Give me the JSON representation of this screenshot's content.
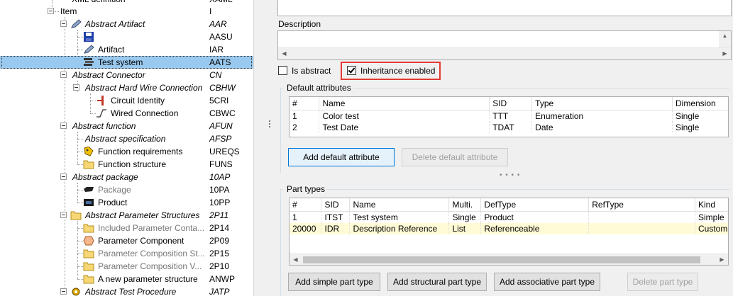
{
  "tree": {
    "top_cut_label": "XML definition",
    "top_cut_sid": "XAML",
    "items": [
      {
        "label": "Item",
        "sid": "I",
        "icon": "none",
        "italic": false,
        "gray": false
      },
      {
        "label": "Abstract Artifact",
        "sid": "AAR",
        "icon": "pen-icon",
        "italic": true,
        "gray": false
      },
      {
        "label": "",
        "sid": "AASU",
        "icon": "floppy-disk-icon",
        "italic": false,
        "gray": false
      },
      {
        "label": "Artifact",
        "sid": "IAR",
        "icon": "pen-icon",
        "italic": false,
        "gray": false
      },
      {
        "label": "Test system",
        "sid": "AATS",
        "icon": "test-system-icon",
        "italic": false,
        "gray": false,
        "selected": true
      },
      {
        "label": "Abstract Connector",
        "sid": "CN",
        "icon": "none",
        "italic": true,
        "gray": false
      },
      {
        "label": "Abstract Hard Wire Connection",
        "sid": "CBHW",
        "icon": "none",
        "italic": true,
        "gray": false
      },
      {
        "label": "Circuit Identity",
        "sid": "5CRI",
        "icon": "connector-pin-icon",
        "italic": false,
        "gray": false
      },
      {
        "label": "Wired Connection",
        "sid": "CBWC",
        "icon": "wire-icon",
        "italic": false,
        "gray": false
      },
      {
        "label": "Abstract function",
        "sid": "AFUN",
        "icon": "none",
        "italic": true,
        "gray": false
      },
      {
        "label": "Abstract specification",
        "sid": "AFSP",
        "icon": "none",
        "italic": true,
        "gray": false
      },
      {
        "label": "Function requirements",
        "sid": "UREQS",
        "icon": "requirements-icon",
        "italic": false,
        "gray": false
      },
      {
        "label": "Function structure",
        "sid": "FUNS",
        "icon": "folder-icon",
        "italic": false,
        "gray": false
      },
      {
        "label": "Abstract package",
        "sid": "10AP",
        "icon": "none",
        "italic": true,
        "gray": false
      },
      {
        "label": "Package",
        "sid": "10PA",
        "icon": "package-icon",
        "italic": false,
        "gray": true
      },
      {
        "label": "Product",
        "sid": "10PP",
        "icon": "product-icon",
        "italic": false,
        "gray": false
      },
      {
        "label": "Abstract Parameter Structures",
        "sid": "2P11",
        "icon": "folder-icon",
        "italic": true,
        "gray": false
      },
      {
        "label": "Included Parameter Conta...",
        "sid": "2P14",
        "icon": "folder-icon",
        "italic": false,
        "gray": true
      },
      {
        "label": "Parameter Component",
        "sid": "2P09",
        "icon": "hexagon-icon",
        "italic": false,
        "gray": false
      },
      {
        "label": "Parameter Composition St...",
        "sid": "2P15",
        "icon": "folder-icon",
        "italic": false,
        "gray": true
      },
      {
        "label": "Parameter Composition V...",
        "sid": "2P10",
        "icon": "folder-icon",
        "italic": false,
        "gray": true
      },
      {
        "label": "A new parameter structure",
        "sid": "ANWP",
        "icon": "folder-icon",
        "italic": false,
        "gray": false
      },
      {
        "label": "Abstract Test Procedure",
        "sid": "JATP",
        "icon": "gear-icon",
        "italic": true,
        "gray": false
      }
    ]
  },
  "details": {
    "description_label": "Description",
    "is_abstract_label": "Is abstract",
    "is_abstract_checked": false,
    "inheritance_label": "Inheritance enabled",
    "inheritance_checked": true,
    "default_attributes": {
      "title": "Default attributes",
      "columns": [
        "#",
        "Name",
        "SID",
        "Type",
        "Dimension"
      ],
      "rows": [
        [
          "1",
          "Color test",
          "TTT",
          "Enumeration",
          "Single"
        ],
        [
          "2",
          "Test Date",
          "TDAT",
          "Date",
          "Single"
        ]
      ],
      "add_button": "Add default attribute",
      "delete_button": "Delete default attribute"
    },
    "part_types": {
      "title": "Part types",
      "columns": [
        "#",
        "SID",
        "Name",
        "Multi.",
        "DefType",
        "RefType",
        "Kind"
      ],
      "rows": [
        [
          "1",
          "ITST",
          "Test system",
          "Single",
          "Product",
          "",
          "Simple"
        ],
        [
          "20000",
          "IDR",
          "Description Reference",
          "List",
          "Referenceable",
          "",
          "Custom"
        ]
      ],
      "buttons": {
        "add_simple": "Add simple part type",
        "add_structural": "Add structural part type",
        "add_associative": "Add associative part type",
        "delete": "Delete part type"
      }
    }
  },
  "colors": {
    "selection": "#99c9ef",
    "highlight_outline": "#e53935",
    "primary_button_border": "#0078d7",
    "row_highlight": "#fffbd6"
  }
}
